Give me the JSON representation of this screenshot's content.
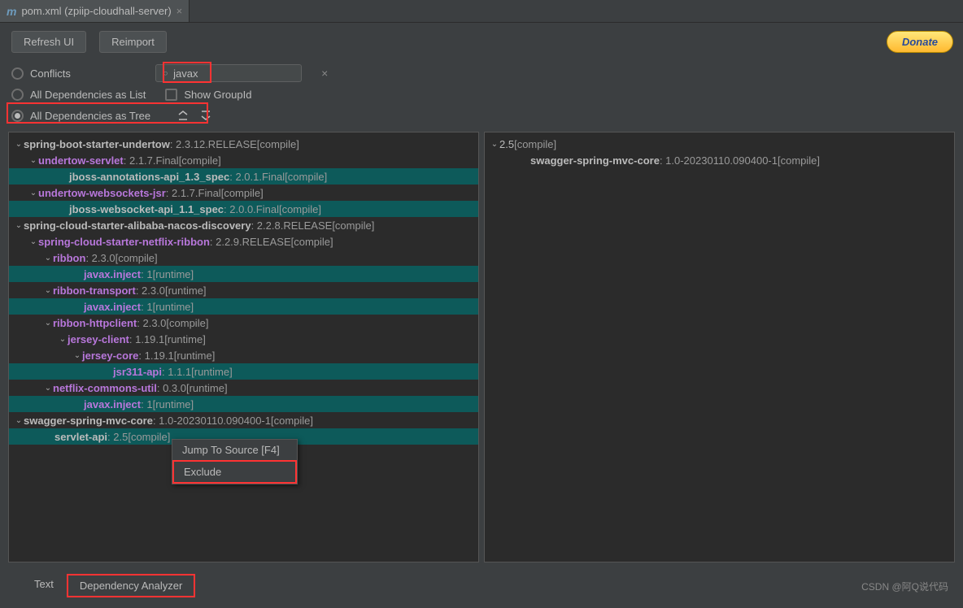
{
  "tab": {
    "icon": "m",
    "title": "pom.xml (zpiip-cloudhall-server)"
  },
  "buttons": {
    "refresh": "Refresh UI",
    "reimport": "Reimport",
    "donate": "Donate"
  },
  "radio": {
    "conflicts": "Conflicts",
    "all_list": "All Dependencies as List",
    "all_tree": "All Dependencies as Tree"
  },
  "checkbox": {
    "show_groupid": "Show GroupId"
  },
  "search": {
    "value": "javax"
  },
  "tree_icons": {
    "collapse": "⇈",
    "expand": "⇊"
  },
  "context_menu": {
    "jump": "Jump To Source [F4]",
    "exclude": "Exclude"
  },
  "bottom_tabs": {
    "text": "Text",
    "analyzer": "Dependency Analyzer"
  },
  "watermark": "CSDN @阿Q说代码",
  "left_tree": [
    {
      "indent": 0,
      "chev": true,
      "name": "spring-boot-starter-undertow",
      "ver": "2.3.12.RELEASE",
      "scope": "[compile]",
      "hl": false,
      "bold": true
    },
    {
      "indent": 1,
      "chev": true,
      "name": "undertow-servlet",
      "ver": "2.1.7.Final",
      "scope": "[compile]",
      "hl": false,
      "bold": true,
      "purple": true
    },
    {
      "indent": 2,
      "text": true,
      "name": "jboss-annotations-api_1.3_spec",
      "ver": "2.0.1.Final",
      "scope": "[compile]",
      "hl": true,
      "bold": true
    },
    {
      "indent": 1,
      "chev": true,
      "name": "undertow-websockets-jsr",
      "ver": "2.1.7.Final",
      "scope": "[compile]",
      "hl": false,
      "bold": true,
      "purple": true
    },
    {
      "indent": 2,
      "text": true,
      "name": "jboss-websocket-api_1.1_spec",
      "ver": "2.0.0.Final",
      "scope": "[compile]",
      "hl": true,
      "bold": true
    },
    {
      "indent": 0,
      "chev": true,
      "name": "spring-cloud-starter-alibaba-nacos-discovery",
      "ver": "2.2.8.RELEASE",
      "scope": "[compile]",
      "hl": false,
      "bold": true
    },
    {
      "indent": 1,
      "chev": true,
      "name": "spring-cloud-starter-netflix-ribbon",
      "ver": "2.2.9.RELEASE",
      "scope": "[compile]",
      "hl": false,
      "bold": true,
      "purple": true
    },
    {
      "indent": 2,
      "chev": true,
      "name": "ribbon",
      "ver": "2.3.0",
      "scope": "[compile]",
      "hl": false,
      "bold": true,
      "purple": true
    },
    {
      "indent": 3,
      "text": true,
      "name": "javax.inject",
      "ver": "1",
      "scope": "[runtime]",
      "hl": true,
      "bold": true,
      "purple": true
    },
    {
      "indent": 2,
      "chev": true,
      "name": "ribbon-transport",
      "ver": "2.3.0",
      "scope": "[runtime]",
      "hl": false,
      "bold": true,
      "purple": true
    },
    {
      "indent": 3,
      "text": true,
      "name": "javax.inject",
      "ver": "1",
      "scope": "[runtime]",
      "hl": true,
      "bold": true,
      "purple": true
    },
    {
      "indent": 2,
      "chev": true,
      "name": "ribbon-httpclient",
      "ver": "2.3.0",
      "scope": "[compile]",
      "hl": false,
      "bold": true,
      "purple": true
    },
    {
      "indent": 3,
      "chev": true,
      "name": "jersey-client",
      "ver": "1.19.1",
      "scope": "[runtime]",
      "hl": false,
      "bold": true,
      "purple": true
    },
    {
      "indent": 4,
      "chev": true,
      "name": "jersey-core",
      "ver": "1.19.1",
      "scope": "[runtime]",
      "hl": false,
      "bold": true,
      "purple": true
    },
    {
      "indent": 5,
      "text": true,
      "name": "jsr311-api",
      "ver": "1.1.1",
      "scope": "[runtime]",
      "hl": true,
      "bold": true,
      "purple": true
    },
    {
      "indent": 2,
      "chev": true,
      "name": "netflix-commons-util",
      "ver": "0.3.0",
      "scope": "[runtime]",
      "hl": false,
      "bold": true,
      "purple": true
    },
    {
      "indent": 3,
      "text": true,
      "name": "javax.inject",
      "ver": "1",
      "scope": "[runtime]",
      "hl": true,
      "bold": true,
      "purple": true
    },
    {
      "indent": 0,
      "chev": true,
      "name": "swagger-spring-mvc-core",
      "ver": "1.0-20230110.090400-1",
      "scope": "[compile]",
      "hl": false,
      "bold": true
    },
    {
      "indent": 1,
      "text": true,
      "name": "servlet-api",
      "ver": "2.5",
      "scope": "[compile]",
      "hl": true,
      "bold": true
    }
  ],
  "right_tree": [
    {
      "indent": 0,
      "chev": true,
      "name": "2.5",
      "scope": "[compile]",
      "hl": false
    },
    {
      "indent": 1,
      "text": true,
      "name": "swagger-spring-mvc-core",
      "ver": "1.0-20230110.090400-1",
      "scope": "[compile]",
      "hl": false,
      "bold": true
    }
  ]
}
